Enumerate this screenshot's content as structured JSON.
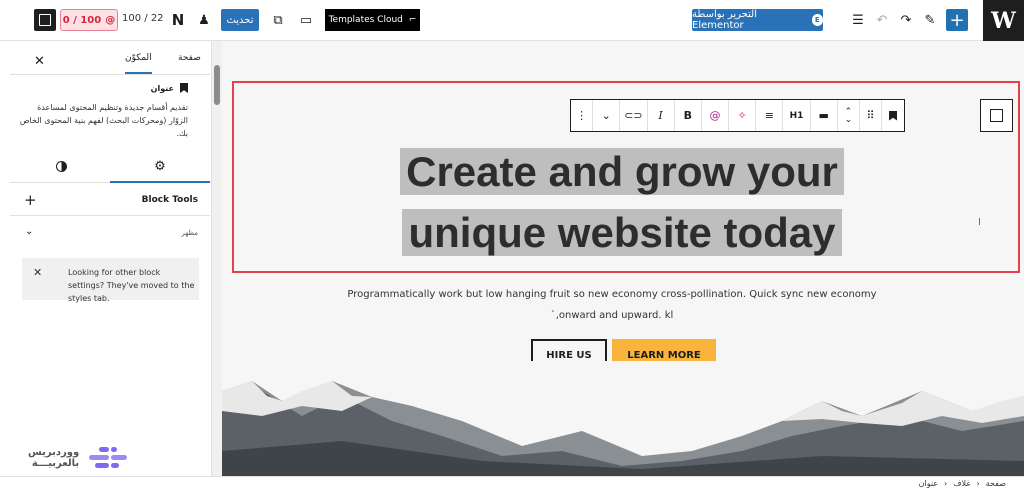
{
  "topbar": {
    "wp_logo": "W",
    "elementor_button": "التحرير بواسطة Elementor",
    "templates_button": "Templates Cloud",
    "update_button": "تحديث",
    "counter": "100 / 22",
    "score_badge": "0 / 100",
    "icons": [
      "plus-icon",
      "pencil-icon",
      "redo-icon",
      "undo-icon",
      "list-view-icon",
      "desktop-icon",
      "external-link-icon",
      "user-icon",
      "notion-icon",
      "sidebar-toggle-icon"
    ]
  },
  "sidebar": {
    "tab_page": "صفحة",
    "tab_block": "المكوّن",
    "block_name": "عنوان",
    "block_description": "تقديم أقسام جديدة وتنظيم المحتوى لمساعدة الزوّار (ومحركات البحث) لفهم بنية المحتوى الخاص بك.",
    "block_tools_label": "Block Tools",
    "appearance_label": "مظهر",
    "notice_text": "Looking for other block settings? They've moved to the styles tab.",
    "brand_text_line1": "ووردبريس",
    "brand_text_line2": "بالعربيـــة"
  },
  "canvas": {
    "headline_line1": "Create and grow your",
    "headline_line2": "unique website today",
    "subtext": "Programmatically work but low hanging fruit so new economy cross-pollination. Quick sync new economy onward and upward.",
    "subtext_suffix": "kl,`",
    "hire_button": "HIRE US",
    "learn_button": "LEARN MORE",
    "toolbar": {
      "heading_level": "H1",
      "bold": "B",
      "italic": "I"
    }
  },
  "breadcrumb": [
    "صفحة",
    "غلاف",
    "عنوان"
  ],
  "colors": {
    "accent": "#2a72b8",
    "selection_border": "#e4404d",
    "cta": "#f9b43b",
    "badge_text": "#d6233f"
  }
}
